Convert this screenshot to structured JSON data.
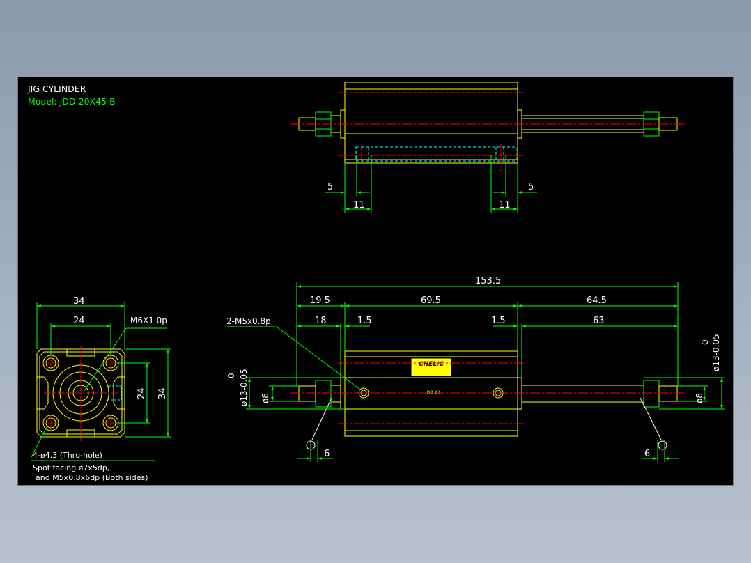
{
  "title": {
    "line1": "JIG CYLINDER",
    "line2": "Model: JDD 20X45-B"
  },
  "colors": {
    "background": "#000000",
    "outline": "#ffff00",
    "dimension": "#00ff00",
    "centerline": "#ff0000",
    "hidden": "#00ffff",
    "title_main": "#ffffff",
    "title_model": "#00ff00"
  },
  "top_view": {
    "dim_left_small": "5",
    "dim_left_large": "11",
    "dim_right_small": "5",
    "dim_right_large": "11"
  },
  "end_view": {
    "dim_width_outer": "34",
    "dim_width_inner": "24",
    "dim_height_inner": "24",
    "dim_height_outer": "34",
    "thread_callout": "M6X1.0p",
    "hole_callout": "4-ø4.3 (Thru-hole)",
    "note_line1": "Spot facing ø7x5dp,",
    "note_line2": "and M5x0.8x6dp (Both sides)"
  },
  "front_view": {
    "dim_overall": "153.5",
    "dim_left_seg": "19.5",
    "dim_body": "69.5",
    "dim_right_seg": "64.5",
    "dim_left_rod": "18",
    "dim_left_gap": "1.5",
    "dim_right_gap": "1.5",
    "dim_right_rod": "63",
    "port_callout": "2-M5x0.8p",
    "rod_dia_left": "ø8",
    "rod_dia_right": "ø8",
    "tol_left_lower": "ø13-0.05",
    "tol_left_upper": "0",
    "tol_right_lower": "ø13-0.05",
    "tol_right_upper": "0",
    "label_brand": "CHELIC",
    "body_text": "JDD 20",
    "dim_bottom_left": "6",
    "dim_bottom_right": "6"
  }
}
